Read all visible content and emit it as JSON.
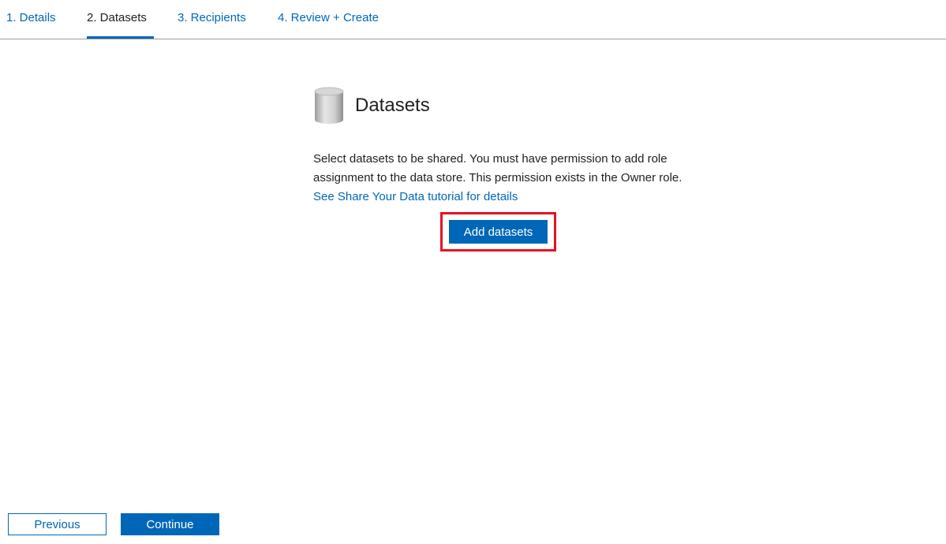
{
  "tabs": [
    {
      "label": "1. Details",
      "active": false
    },
    {
      "label": "2. Datasets",
      "active": true
    },
    {
      "label": "3. Recipients",
      "active": false
    },
    {
      "label": "4. Review + Create",
      "active": false
    }
  ],
  "section": {
    "icon": "database-icon",
    "title": "Datasets",
    "description": "Select datasets to be shared. You must have permission to add role assignment to the data store. This permission exists in the Owner role.",
    "link_text": "See Share Your Data tutorial for details"
  },
  "add_button_label": "Add datasets",
  "footer": {
    "previous_label": "Previous",
    "continue_label": "Continue"
  },
  "colors": {
    "accent": "#0067b8",
    "highlight": "#e81123"
  }
}
